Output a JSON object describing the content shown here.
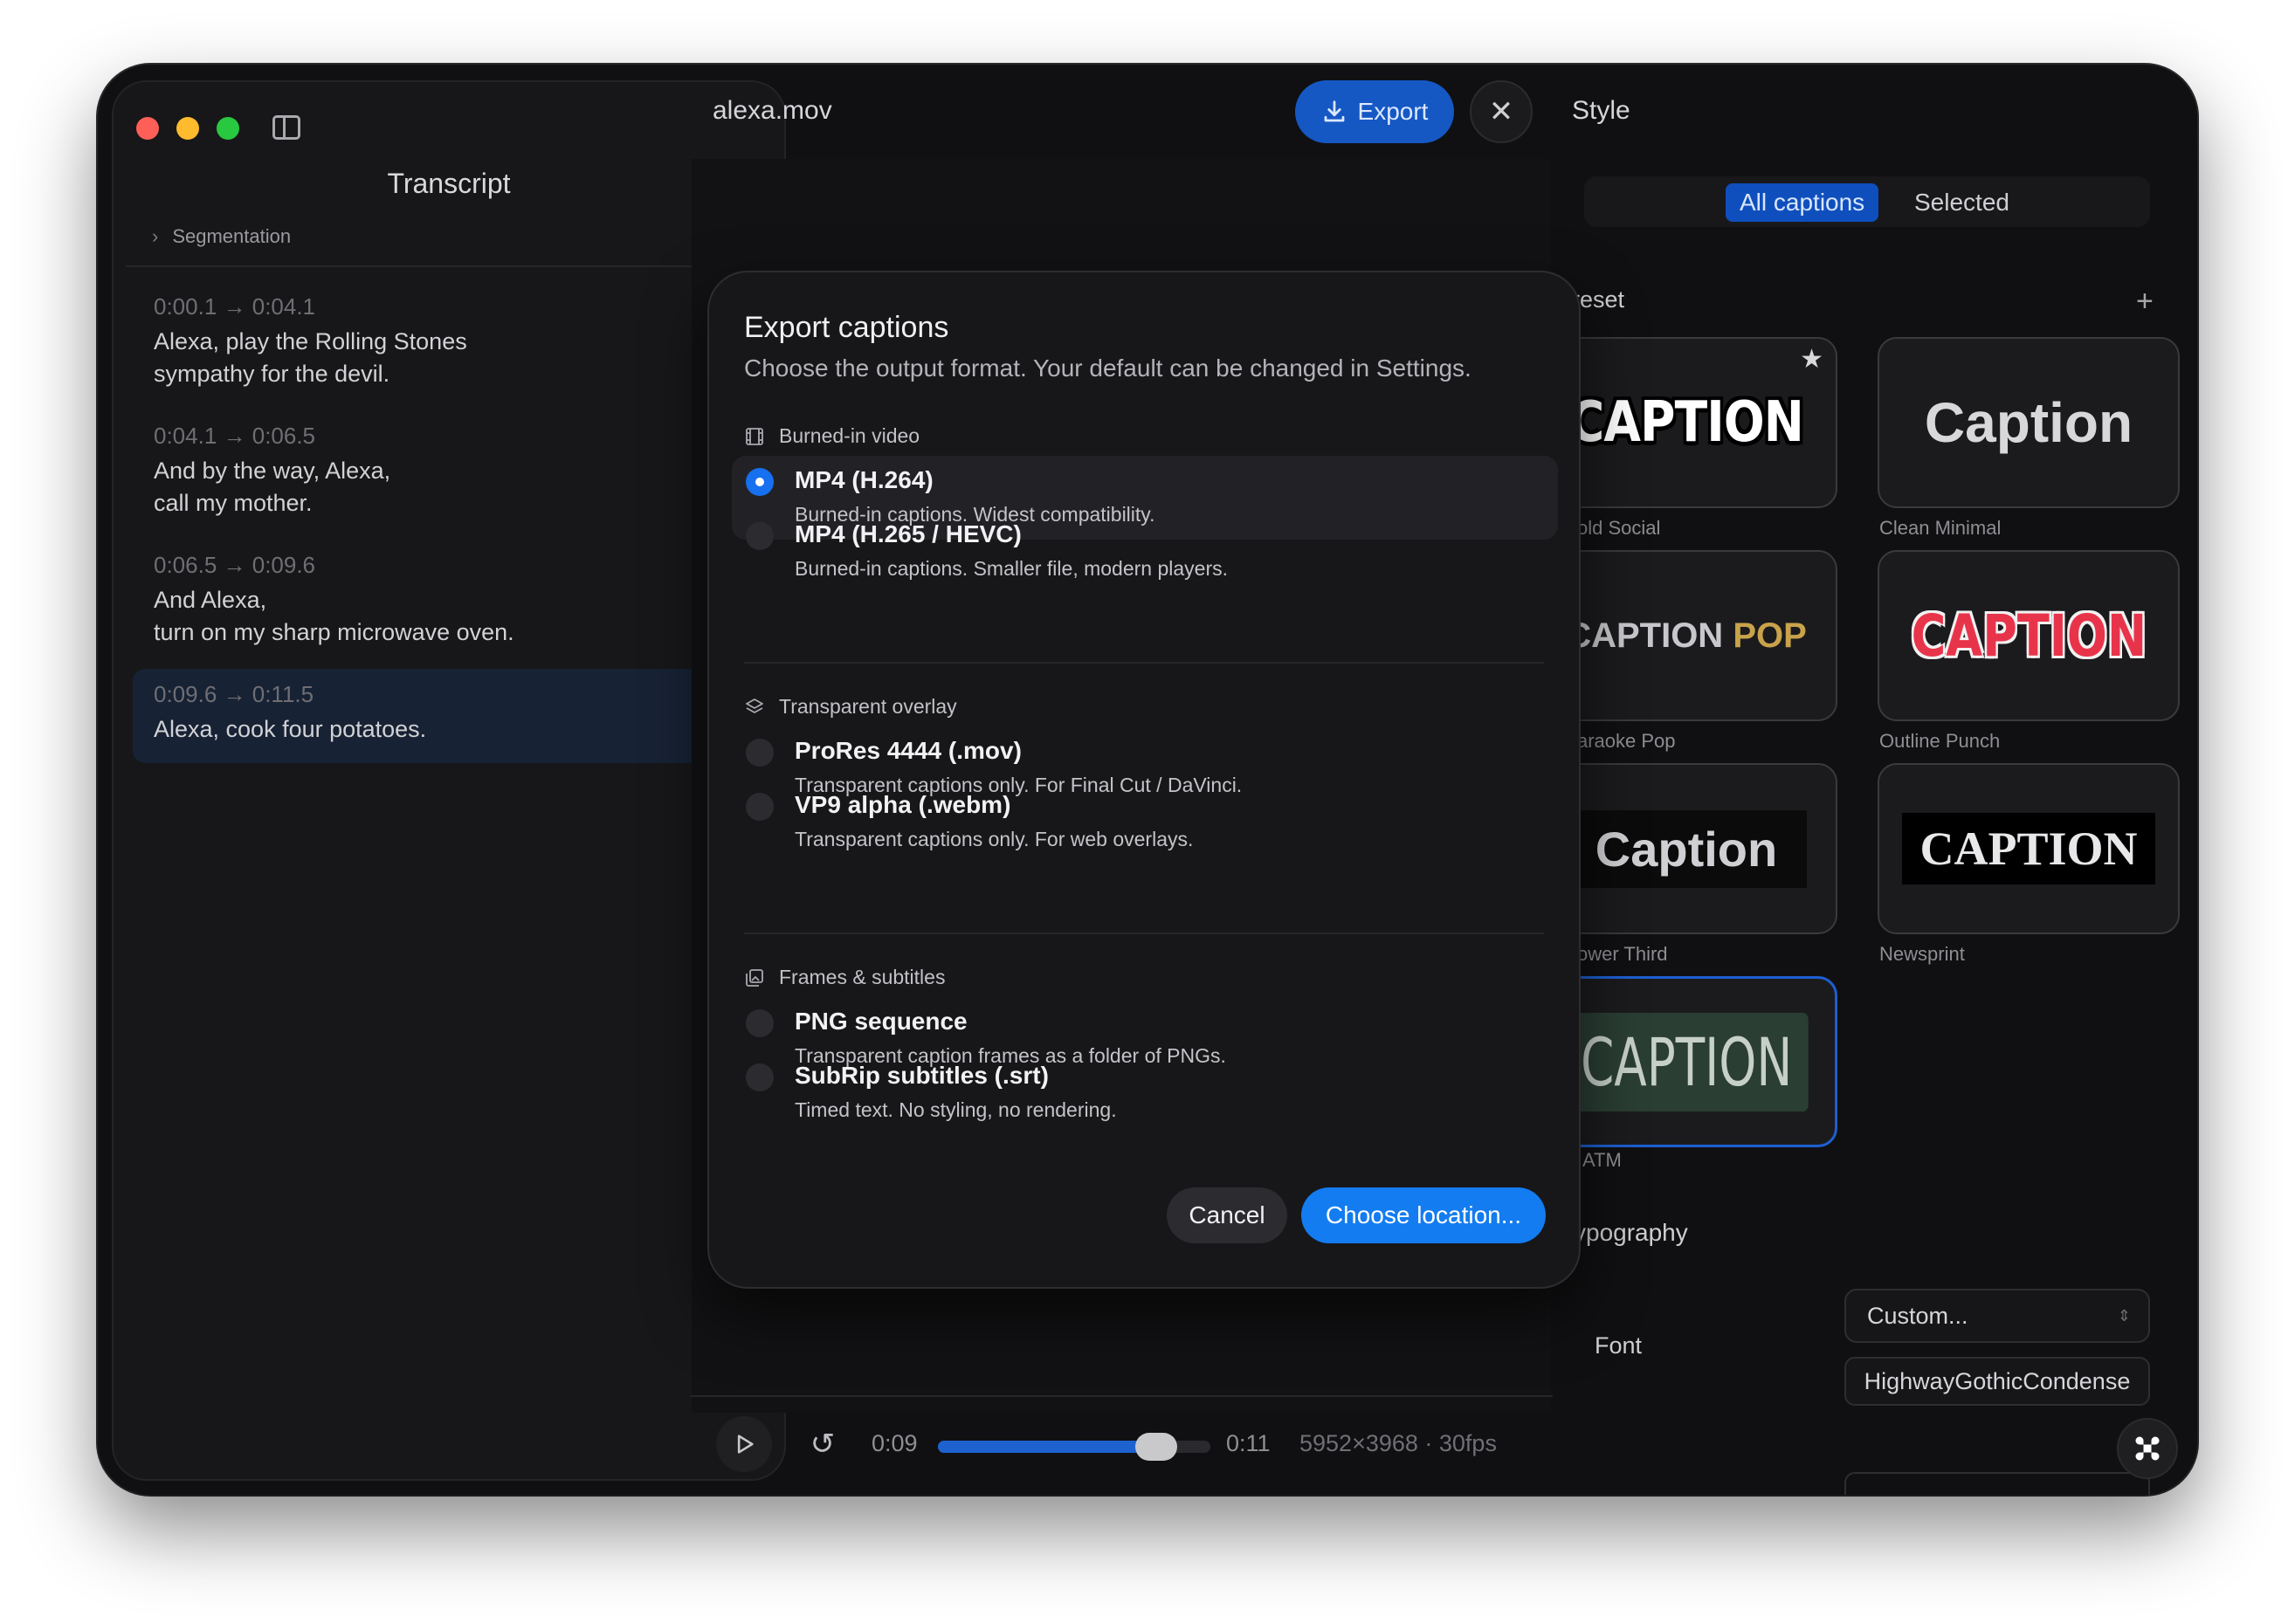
{
  "sidebar": {
    "title": "Transcript",
    "segmentation_label": "Segmentation",
    "segments": [
      {
        "time": "0:00.1 → 0:04.1",
        "text": "Alexa, play the Rolling Stones\nsympathy for the devil."
      },
      {
        "time": "0:04.1 → 0:06.5",
        "text": "And by the way, Alexa,\ncall my mother."
      },
      {
        "time": "0:06.5 → 0:09.6",
        "text": "And Alexa,\nturn on my sharp microwave oven."
      },
      {
        "time": "0:09.6 → 0:11.5",
        "text": "Alexa, cook four potatoes."
      }
    ]
  },
  "header": {
    "file_name": "alexa.mov",
    "export_label": "Export"
  },
  "player": {
    "current_time": "0:09",
    "duration": "0:11",
    "meta": "5952×3968 · 30fps",
    "progress": 0.8
  },
  "style_panel": {
    "title": "Style",
    "tabs": [
      "All captions",
      "Selected"
    ],
    "active_tab": "All captions",
    "preset_label": "reset",
    "presets": [
      {
        "name": "old Social",
        "sample": "CAPTION",
        "starred": true
      },
      {
        "name": "Clean Minimal",
        "sample": "Caption"
      },
      {
        "name": "araoke Pop",
        "sample": "CAPTION",
        "sample_accent": "POP"
      },
      {
        "name": "Outline Punch",
        "sample": "CAPTION"
      },
      {
        "name": "ower Third",
        "sample": "Caption"
      },
      {
        "name": "Newsprint",
        "sample": "CAPTION"
      },
      {
        "name": "ATM",
        "sample": "CAPTION",
        "selected": true
      }
    ],
    "typography_label": "ypography",
    "font_label": "Font",
    "font_select": "Custom...",
    "font_name": "HighwayGothicCondense"
  },
  "dialog": {
    "title": "Export captions",
    "subtitle": "Choose the output format. Your default can be changed in Settings.",
    "groups": [
      {
        "label": "Burned-in video",
        "icon": "film-icon",
        "options": [
          {
            "title": "MP4 (H.264)",
            "desc": "Burned-in captions. Widest compatibility.",
            "selected": true
          },
          {
            "title": "MP4 (H.265 / HEVC)",
            "desc": "Burned-in captions. Smaller file, modern players."
          }
        ]
      },
      {
        "label": "Transparent overlay",
        "icon": "layers-icon",
        "options": [
          {
            "title": "ProRes 4444 (.mov)",
            "desc": "Transparent captions only. For Final Cut / DaVinci."
          },
          {
            "title": "VP9 alpha (.webm)",
            "desc": "Transparent captions only. For web overlays."
          }
        ]
      },
      {
        "label": "Frames & subtitles",
        "icon": "images-icon",
        "options": [
          {
            "title": "PNG sequence",
            "desc": "Transparent caption frames as a folder of PNGs."
          },
          {
            "title": "SubRip subtitles (.srt)",
            "desc": "Timed text. No styling, no rendering."
          }
        ]
      }
    ],
    "cancel_label": "Cancel",
    "confirm_label": "Choose location..."
  },
  "colors": {
    "accent": "#137cf0",
    "selected_segment": "#172234",
    "window_bg": "#101012"
  }
}
